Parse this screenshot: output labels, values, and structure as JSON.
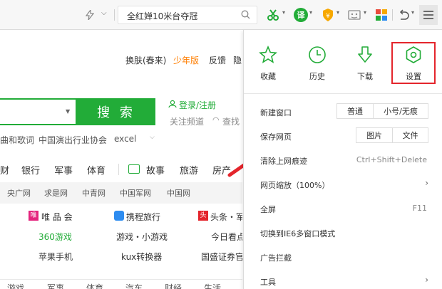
{
  "toolbar": {
    "search_value": "全红婵10米台夺冠",
    "icons": [
      "lightning-icon",
      "chevron-down-icon",
      "search-icon",
      "scissors-icon",
      "translate-icon",
      "shield-icon",
      "screenshot-icon",
      "apps-icon",
      "undo-icon",
      "menu-icon"
    ],
    "translate_label": "译"
  },
  "page": {
    "topnav": [
      "换肤(春来)",
      "少年版",
      "反馈",
      "隐"
    ],
    "search_button": "搜 索",
    "login": "登录/注册",
    "follow": "关注频道",
    "lookup": "查找",
    "hints": [
      "曲和歌词",
      "中国演出行业协会",
      "excel"
    ],
    "categories": [
      "财",
      "银行",
      "军事",
      "体育",
      "故事",
      "旅游",
      "房产"
    ],
    "subrow": [
      "央广网",
      "求是网",
      "中青网",
      "中国军网",
      "中国网"
    ],
    "links": [
      [
        "唯 品 会",
        "携程旅行",
        "头条・军"
      ],
      [
        "360游戏",
        "游戏・小游戏",
        "今日看点"
      ],
      [
        "苹果手机",
        "kux转换器",
        "国盛证券官"
      ]
    ],
    "bottom": [
      "游戏",
      "军事",
      "体育",
      "汽车",
      "财经",
      "生活"
    ]
  },
  "menu": {
    "top_items": [
      {
        "label": "收藏",
        "icon": "star-icon"
      },
      {
        "label": "历史",
        "icon": "clock-icon"
      },
      {
        "label": "下载",
        "icon": "download-icon"
      },
      {
        "label": "设置",
        "icon": "gear-icon"
      }
    ],
    "items": [
      {
        "label": "新建窗口",
        "pill1": "普通",
        "pill2": "小号/无痕"
      },
      {
        "label": "保存网页",
        "pill1": "图片",
        "pill2": "文件"
      },
      {
        "label": "清除上网痕迹",
        "shortcut": "Ctrl+Shift+Delete"
      },
      {
        "label": "网页缩放（100%）"
      },
      {
        "label": "全屏",
        "shortcut": "F11"
      },
      {
        "label": "切换到IE6多窗口模式"
      },
      {
        "label": "广告拦截"
      },
      {
        "label": "工具"
      }
    ]
  },
  "colors": {
    "brand_green": "#22ac38",
    "highlight_red": "#e4252c",
    "accent_orange": "#ff7e00"
  }
}
